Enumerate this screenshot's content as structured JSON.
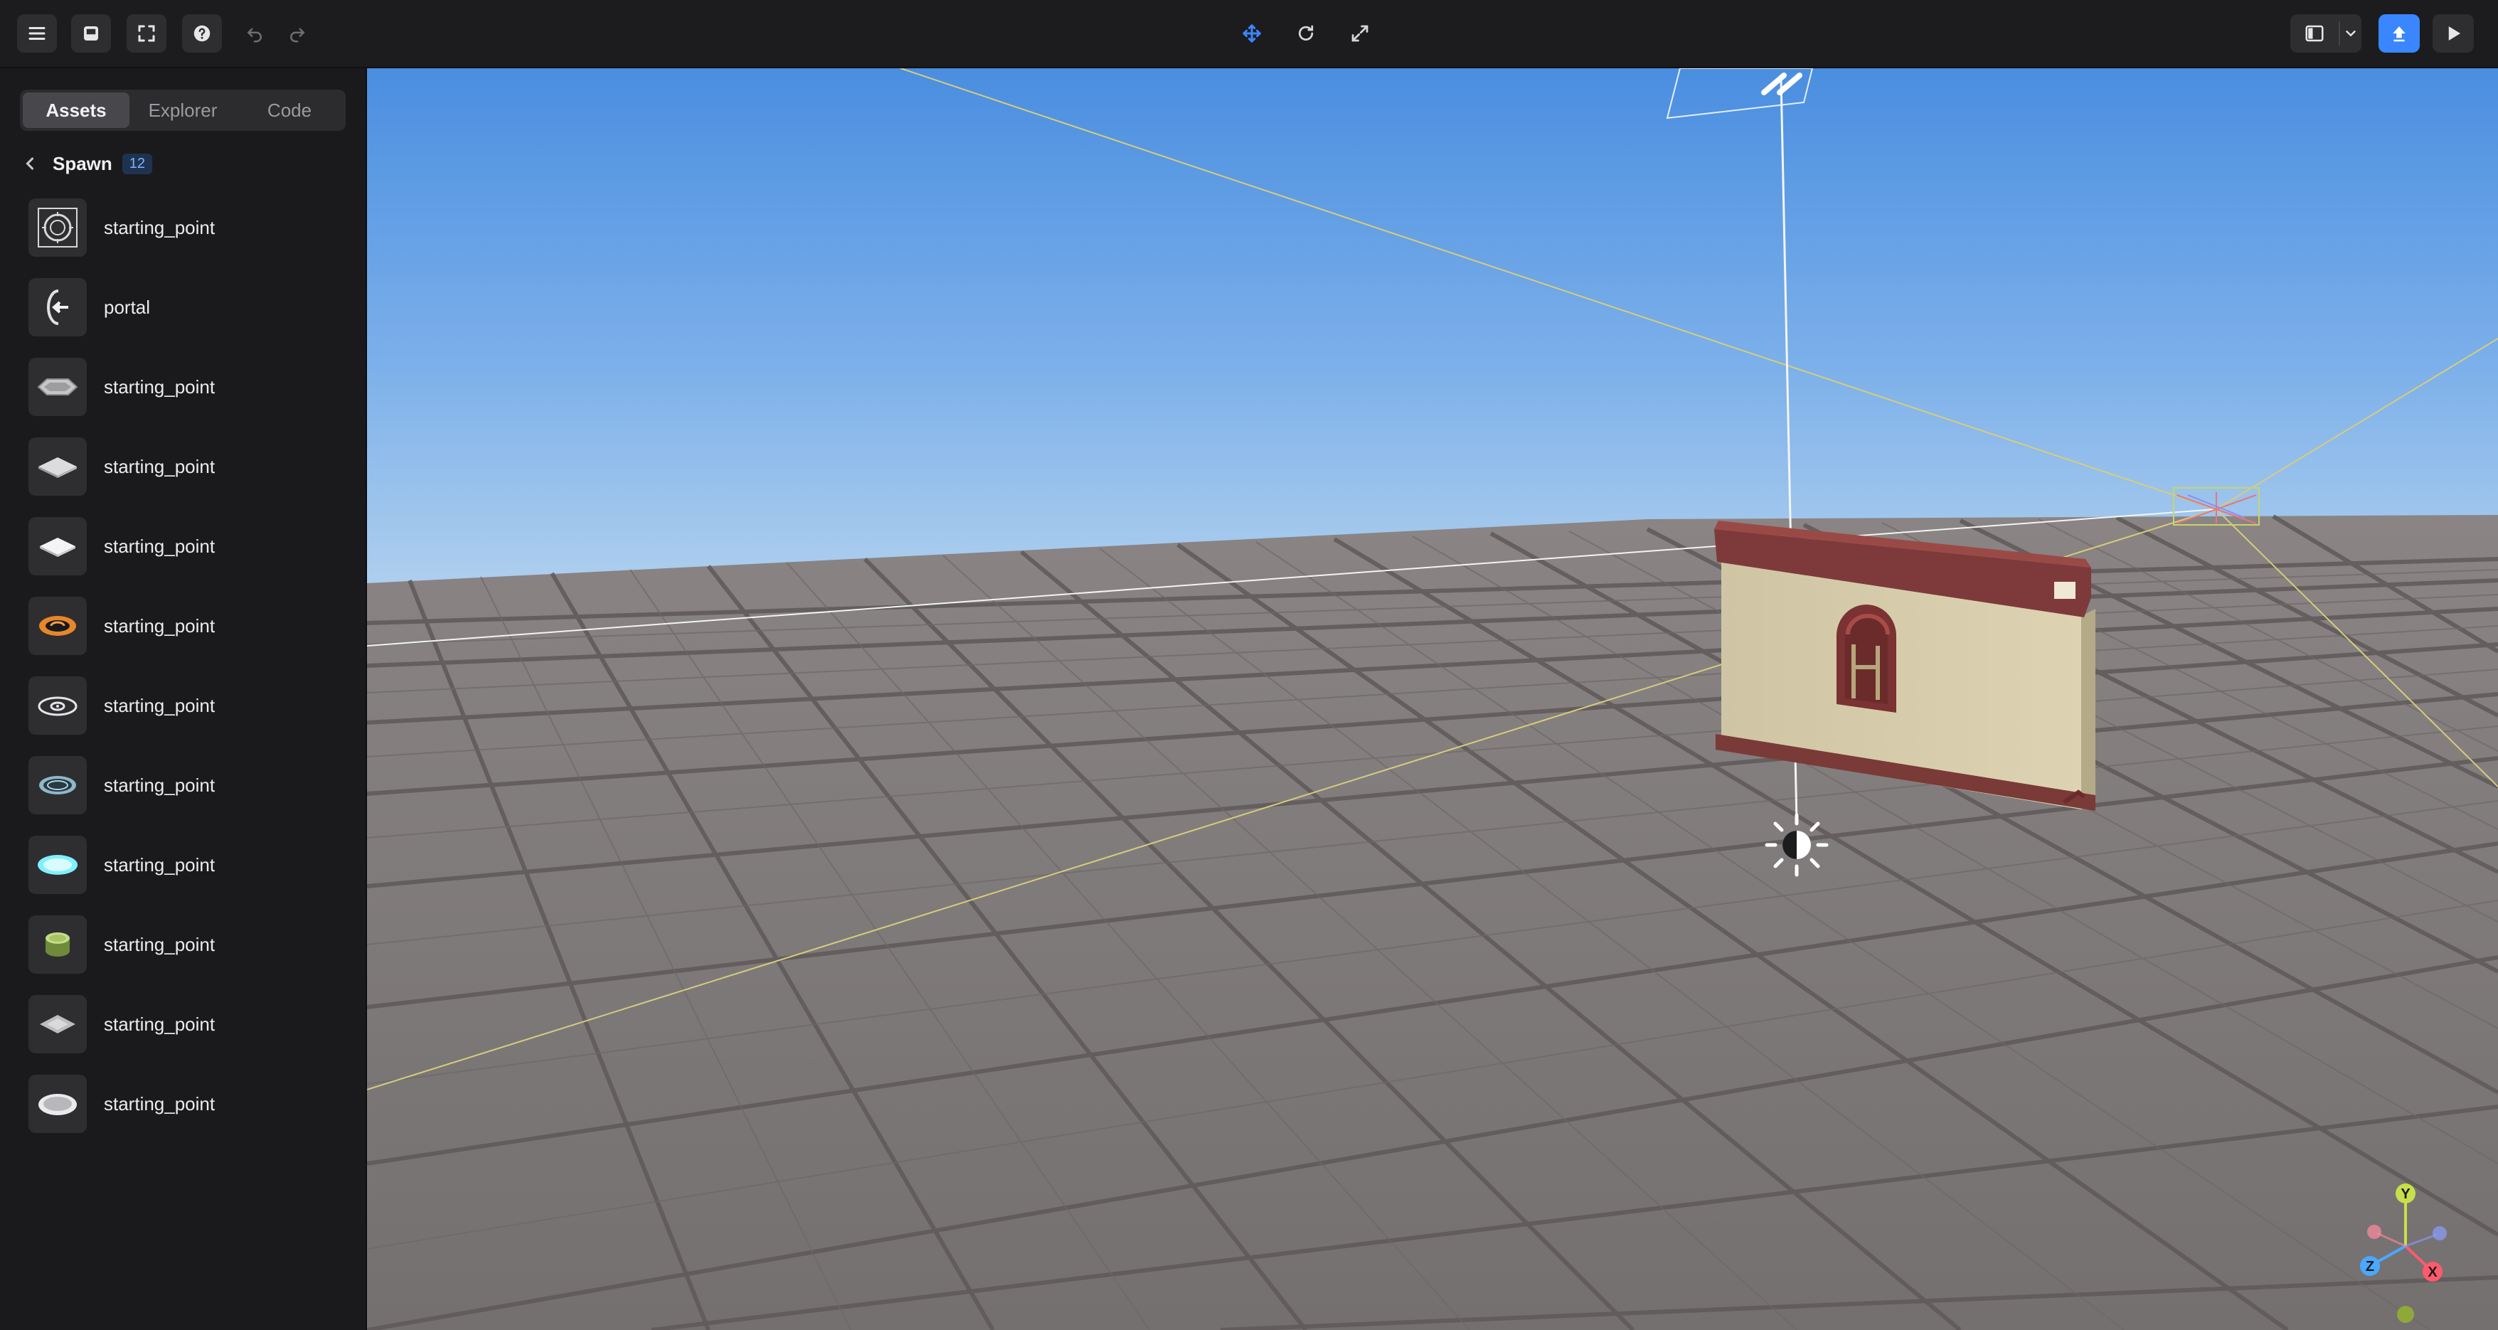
{
  "toolbar": {
    "left_buttons": [
      "menu-icon",
      "inbox-icon",
      "frame-icon",
      "help-icon",
      "undo-icon",
      "redo-icon"
    ],
    "center_buttons": [
      "move-icon",
      "rotate-icon",
      "scale-icon"
    ],
    "right_buttons": [
      "layout-toggle-icon",
      "chevron-down-icon",
      "publish-icon",
      "play-icon"
    ],
    "accent": "#3a86ff"
  },
  "sidebar": {
    "tabs": [
      {
        "label": "Assets",
        "active": true
      },
      {
        "label": "Explorer",
        "active": false
      },
      {
        "label": "Code",
        "active": false
      }
    ],
    "category": {
      "title": "Spawn",
      "count": "12"
    },
    "items": [
      {
        "label": "starting_point",
        "icon": "target-ring-icon"
      },
      {
        "label": "portal",
        "icon": "portal-arrow-icon"
      },
      {
        "label": "starting_point",
        "icon": "octagon-pad-icon"
      },
      {
        "label": "starting_point",
        "icon": "diamond-pad-icon"
      },
      {
        "label": "starting_point",
        "icon": "white-diamond-pad-icon"
      },
      {
        "label": "starting_point",
        "icon": "orange-ring-icon"
      },
      {
        "label": "starting_point",
        "icon": "orbit-ring-icon"
      },
      {
        "label": "starting_point",
        "icon": "blue-ring-icon"
      },
      {
        "label": "starting_point",
        "icon": "glowing-cyan-pad-icon"
      },
      {
        "label": "starting_point",
        "icon": "green-cylinder-icon"
      },
      {
        "label": "starting_point",
        "icon": "gray-diamond-pad-icon"
      },
      {
        "label": "starting_point",
        "icon": "oval-pad-icon"
      }
    ]
  },
  "viewport": {
    "sky_top": "#4a8ee0",
    "sky_horizon": "#b4d2ee",
    "floor_color": "#7a7474",
    "gizmo_axes": [
      "Y",
      "Z",
      "X"
    ]
  }
}
